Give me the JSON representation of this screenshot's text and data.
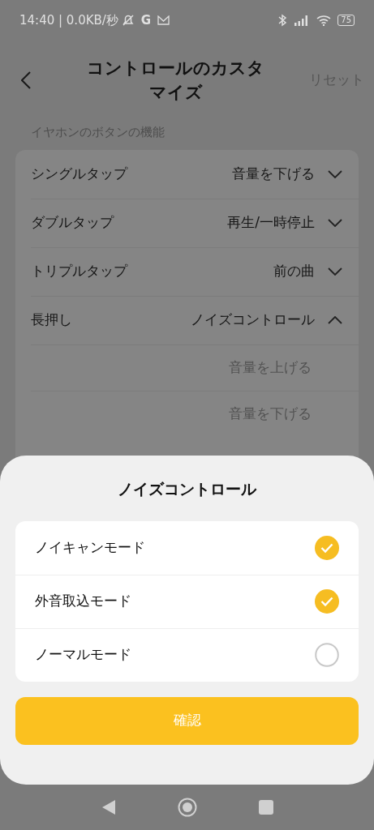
{
  "status_bar": {
    "time": "14:40 | 0.0KB/秒",
    "notification_letter": "G",
    "battery": "75"
  },
  "header": {
    "title": "コントロールのカスタマイズ",
    "reset": "リセット"
  },
  "section_label": "イヤホンのボタンの機能",
  "controls": [
    {
      "label": "シングルタップ",
      "value": "音量を下げる",
      "expanded": false
    },
    {
      "label": "ダブルタップ",
      "value": "再生/一時停止",
      "expanded": false
    },
    {
      "label": "トリプルタップ",
      "value": "前の曲",
      "expanded": false
    },
    {
      "label": "長押し",
      "value": "ノイズコントロール",
      "expanded": true,
      "options": [
        "音量を上げる",
        "音量を下げる"
      ]
    }
  ],
  "sheet": {
    "title": "ノイズコントロール",
    "options": [
      {
        "label": "ノイキャンモード",
        "checked": true
      },
      {
        "label": "外音取込モード",
        "checked": true
      },
      {
        "label": "ノーマルモード",
        "checked": false
      }
    ],
    "confirm": "確認"
  }
}
